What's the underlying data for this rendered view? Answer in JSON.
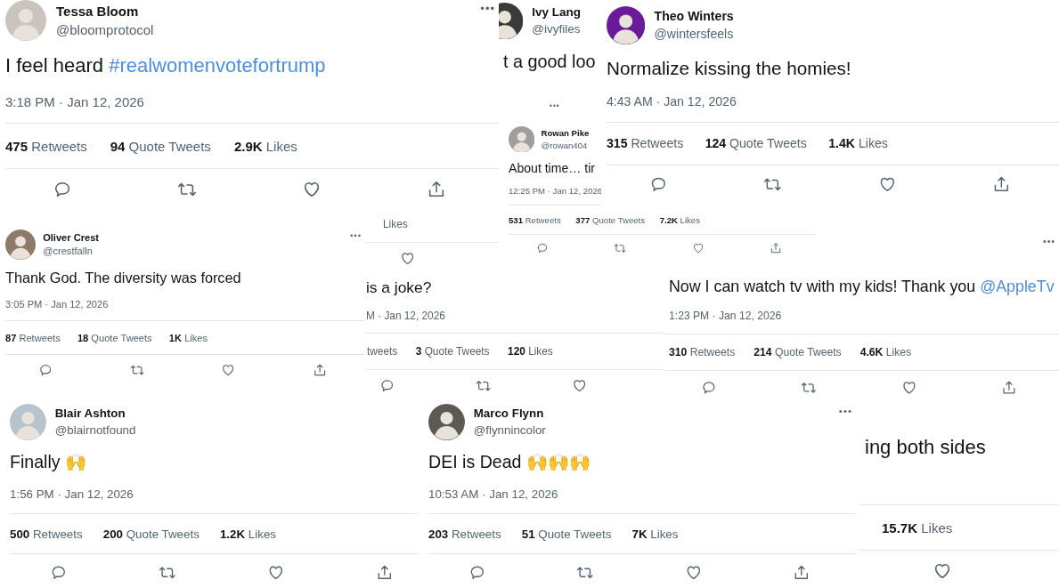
{
  "tweets": [
    {
      "avatar": true,
      "name": "Tessa Bloom",
      "handle": "@bloomprotocol",
      "more": "•••",
      "text": "I feel heard ",
      "link": "#realwomenvotefortrump",
      "time": "3:18 PM · Jan 12, 2026",
      "stats": [
        {
          "count": "475",
          "label": "Retweets"
        },
        {
          "count": "94",
          "label": "Quote Tweets"
        },
        {
          "count": "2.9K",
          "label": "Likes"
        }
      ],
      "actions": [
        {
          "kind": "reply"
        },
        {
          "kind": "retweet"
        },
        {
          "kind": "like"
        },
        {
          "kind": "share"
        }
      ]
    },
    {
      "avatar": true,
      "name": "Ivy Lang",
      "handle": "@ivyfiles",
      "text": "t a good loo"
    },
    {
      "avatar": true,
      "name": "Theo Winters",
      "handle": "@wintersfeels",
      "text": "Normalize kissing the homies!",
      "time": "4:43 AM · Jan 12, 2026",
      "stats": [
        {
          "count": "315",
          "label": "Retweets"
        },
        {
          "count": "124",
          "label": "Quote Tweets"
        },
        {
          "count": "1.4K",
          "label": "Likes"
        }
      ],
      "actions": [
        {
          "kind": "reply"
        },
        {
          "kind": "retweet"
        },
        {
          "kind": "like"
        },
        {
          "kind": "share"
        }
      ]
    },
    {
      "avatar": true,
      "name": "Rowan Pike",
      "handle": "@rowan404",
      "more": "•••",
      "text": "About time… tir",
      "time": "12:25 PM · Jan 12, 2026",
      "stats": [
        {
          "count": "531",
          "label": "Retweets"
        },
        {
          "count": "377",
          "label": "Quote Tweets"
        },
        {
          "count": "7.2K",
          "label": "Likes"
        }
      ],
      "actions": [
        {
          "kind": "reply"
        },
        {
          "kind": "retweet"
        },
        {
          "kind": "like"
        },
        {
          "kind": "share"
        }
      ]
    },
    {
      "avatar": true,
      "name": "Oliver Crest",
      "handle": "@crestfalln",
      "more": "•••",
      "text": "Thank God. The diversity was forced",
      "time": "3:05 PM · Jan 12, 2026",
      "stats": [
        {
          "count": "87",
          "label": "Retweets"
        },
        {
          "count": "18",
          "label": "Quote Tweets"
        },
        {
          "count": "1K",
          "label": "Likes"
        }
      ],
      "actions": [
        {
          "kind": "reply"
        },
        {
          "kind": "retweet"
        },
        {
          "kind": "like"
        },
        {
          "kind": "share"
        }
      ]
    },
    {
      "stats": [
        {
          "label": "Likes"
        }
      ],
      "actions": [
        {
          "kind": "like"
        }
      ]
    },
    {
      "text": "is a joke?",
      "time": "M · Jan 12, 2026",
      "stats": [
        {
          "label": "tweets"
        },
        {
          "count": "3",
          "label": "Quote Tweets"
        },
        {
          "count": "120",
          "label": "Likes"
        }
      ],
      "actions": [
        {
          "kind": "reply"
        },
        {
          "kind": "retweet"
        },
        {
          "kind": "like"
        }
      ]
    },
    {
      "more": "•••",
      "text": "Now I can watch tv with my kids! Thank you ",
      "link": "@AppleTv",
      "time": "1:23 PM · Jan 12, 2026",
      "stats": [
        {
          "count": "310",
          "label": "Retweets"
        },
        {
          "count": "214",
          "label": "Quote Tweets"
        },
        {
          "count": "4.6K",
          "label": "Likes"
        }
      ],
      "actions": [
        {
          "kind": "reply"
        },
        {
          "kind": "retweet"
        },
        {
          "kind": "like"
        },
        {
          "kind": "share"
        }
      ]
    },
    {
      "text": "ing both sides",
      "stats": [
        {
          "count": "15.7K",
          "label": "Likes"
        }
      ],
      "actions": [
        {
          "kind": "like"
        }
      ]
    },
    {
      "avatar": true,
      "name": "Blair Ashton",
      "handle": "@blairnotfound",
      "text": "Finally 🙌",
      "time": "1:56 PM · Jan 12, 2026",
      "stats": [
        {
          "count": "500",
          "label": "Retweets"
        },
        {
          "count": "200",
          "label": "Quote Tweets"
        },
        {
          "count": "1.2K",
          "label": "Likes"
        }
      ],
      "actions": [
        {
          "kind": "reply"
        },
        {
          "kind": "retweet"
        },
        {
          "kind": "like"
        },
        {
          "kind": "share"
        }
      ]
    },
    {
      "avatar": true,
      "name": "Marco Flynn",
      "handle": "@flynnincolor",
      "more": "•••",
      "text": "DEI is Dead 🙌🙌🙌",
      "time": "10:53 AM · Jan 12, 2026",
      "stats": [
        {
          "count": "203",
          "label": "Retweets"
        },
        {
          "count": "51",
          "label": "Quote Tweets"
        },
        {
          "count": "7K",
          "label": "Likes"
        }
      ],
      "actions": [
        {
          "kind": "reply"
        },
        {
          "kind": "retweet"
        },
        {
          "kind": "like"
        },
        {
          "kind": "share"
        }
      ]
    }
  ]
}
